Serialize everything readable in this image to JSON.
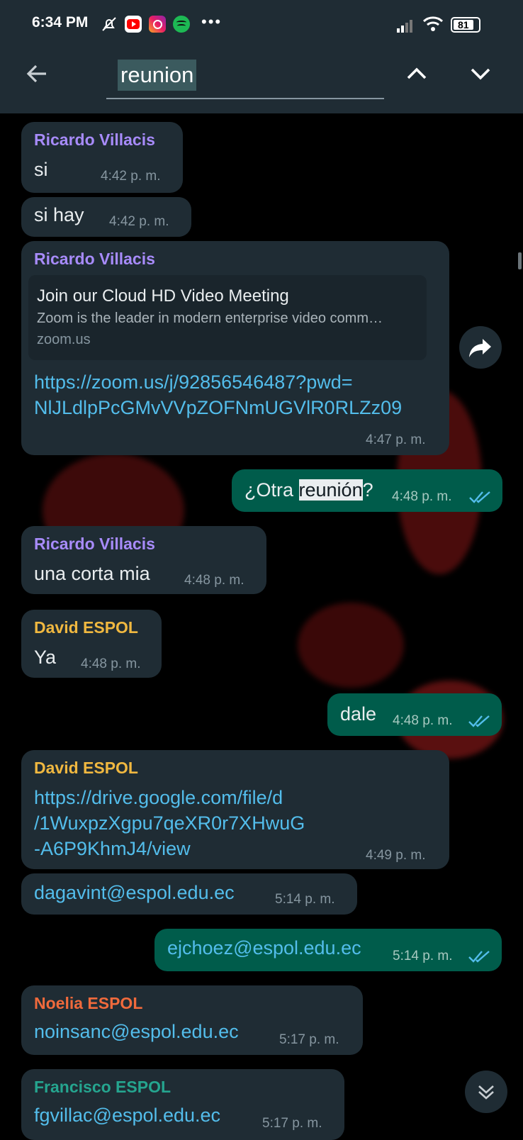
{
  "status_bar": {
    "time": "6:34 PM",
    "more": "•••",
    "battery": "81"
  },
  "search": {
    "query": "reunion"
  },
  "messages": [
    {
      "sender": "Ricardo Villacis",
      "text": "si",
      "time": "4:42 p. m."
    },
    {
      "text": "si hay",
      "time": "4:42 p. m."
    },
    {
      "sender": "Ricardo Villacis",
      "preview_title": "Join our Cloud HD Video Meeting",
      "preview_desc": "Zoom is the leader in modern enterprise video comm…",
      "preview_domain": "zoom.us",
      "link_line1": "https://zoom.us/j/92856546487?pwd=",
      "link_line2": "NlJLdlpPcGMvVVpZOFNmUGVlR0RLZz09",
      "time": "4:47 p. m."
    },
    {
      "text_before": "¿Otra ",
      "text_highlight": "reunión",
      "text_after": "?",
      "time": "4:48 p. m."
    },
    {
      "sender": "Ricardo Villacis",
      "text": "una corta mia",
      "time": "4:48 p. m."
    },
    {
      "sender": "David ESPOL",
      "text": "Ya",
      "time": "4:48 p. m."
    },
    {
      "text": "dale",
      "time": "4:48 p. m."
    },
    {
      "sender": "David ESPOL",
      "link_line1": "https://drive.google.com/file/d",
      "link_line2": "/1WuxpzXgpu7qeXR0r7XHwuG",
      "link_line3": "-A6P9KhmJ4/view",
      "time": "4:49 p. m."
    },
    {
      "text": "dagavint@espol.edu.ec",
      "time": "5:14 p. m."
    },
    {
      "text": "ejchoez@espol.edu.ec",
      "time": "5:14 p. m."
    },
    {
      "sender": "Noelia ESPOL",
      "text": "noinsanc@espol.edu.ec",
      "time": "5:17 p. m."
    },
    {
      "sender": "Francisco ESPOL",
      "text": "fgvillac@espol.edu.ec",
      "time": "5:17 p. m."
    }
  ],
  "colors": {
    "header": "#1f2c34",
    "incoming": "#1f2c34",
    "outgoing": "#005c4b",
    "ricardo": "#a78bfa",
    "david": "#f0b840",
    "noelia": "#f06a3c",
    "francisco": "#25a58f",
    "link": "#53bdeb",
    "read_ticks": "#53bdeb"
  },
  "icons": [
    "back-arrow-icon",
    "chevron-up-icon",
    "chevron-down-icon",
    "share-icon",
    "scroll-down-icon",
    "mute-icon",
    "youtube-icon",
    "instagram-icon",
    "spotify-icon",
    "signal-icon",
    "wifi-icon",
    "battery-icon"
  ]
}
